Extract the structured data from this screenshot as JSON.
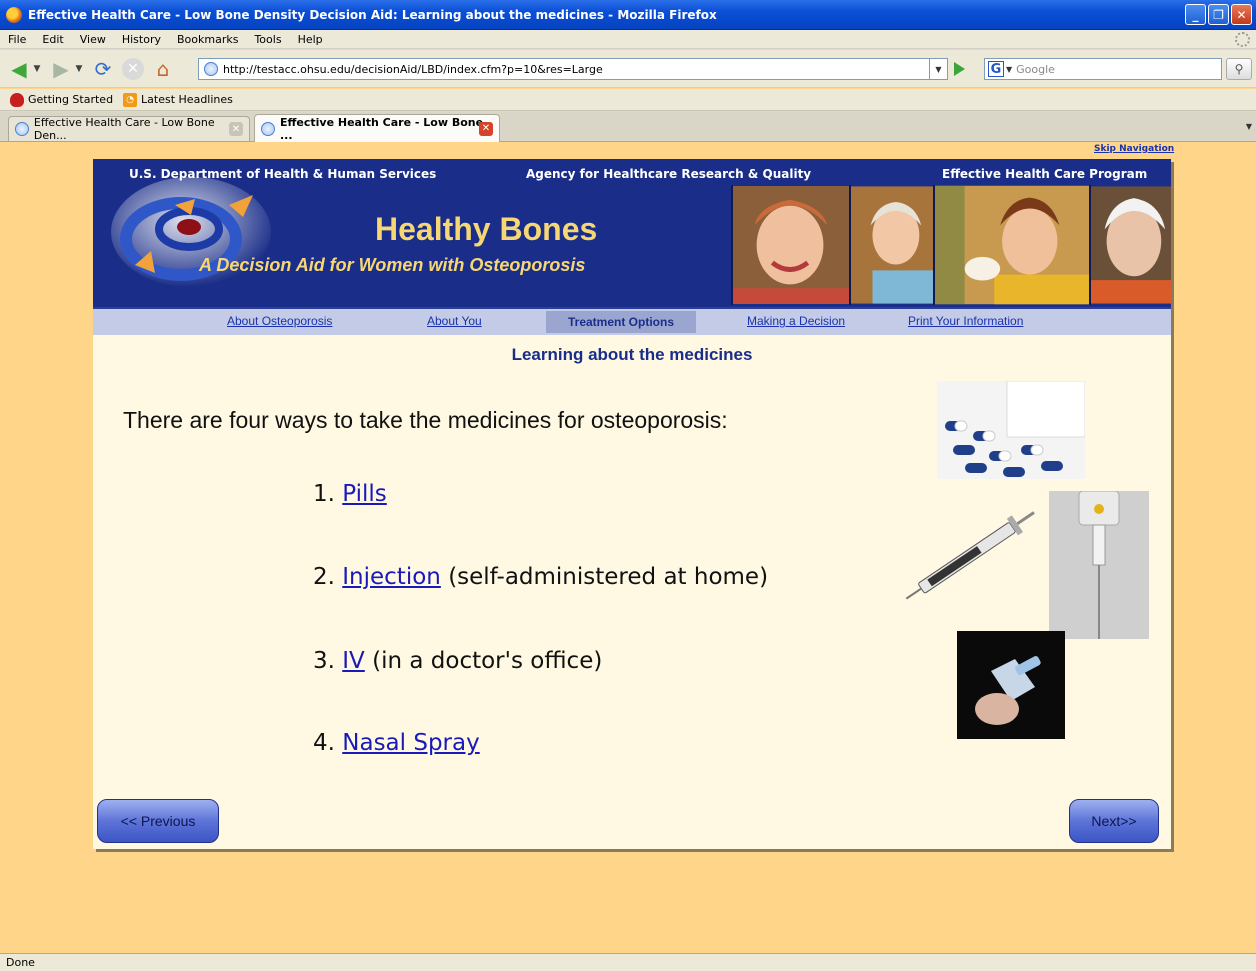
{
  "window": {
    "title": "Effective Health Care - Low Bone Density Decision Aid: Learning about the medicines - Mozilla Firefox"
  },
  "menu": [
    "File",
    "Edit",
    "View",
    "History",
    "Bookmarks",
    "Tools",
    "Help"
  ],
  "address": {
    "url": "http://testacc.ohsu.edu/decisionAid/LBD/index.cfm?p=10&res=Large",
    "search_placeholder": "Google"
  },
  "bookmarks": [
    "Getting Started",
    "Latest Headlines"
  ],
  "tabs": [
    {
      "label": "Effective Health Care - Low Bone Den..."
    },
    {
      "label": "Effective Health Care - Low Bone ..."
    }
  ],
  "page": {
    "skip_nav": "Skip Navigation",
    "banner": {
      "dept": "U.S. Department of Health & Human Services",
      "agency": "Agency for Healthcare Research & Quality",
      "program": "Effective Health Care Program",
      "title": "Healthy Bones",
      "subtitle": "A Decision Aid for Women with Osteoporosis"
    },
    "nav": [
      "About Osteoporosis",
      "About You",
      "Treatment Options",
      "Making a Decision",
      "Print Your Information"
    ],
    "heading": "Learning about the medicines",
    "intro": "There are four ways to take the medicines for osteoporosis:",
    "options": [
      {
        "num": "1.",
        "link": "Pills",
        "note": ""
      },
      {
        "num": "2.",
        "link": "Injection",
        "note": "(self-administered at home)"
      },
      {
        "num": "3.",
        "link": "IV",
        "note": "(in a doctor's office)"
      },
      {
        "num": "4.",
        "link": "Nasal Spray",
        "note": ""
      }
    ],
    "prev_label": "<< Previous",
    "next_label": "Next>>"
  },
  "status": "Done"
}
